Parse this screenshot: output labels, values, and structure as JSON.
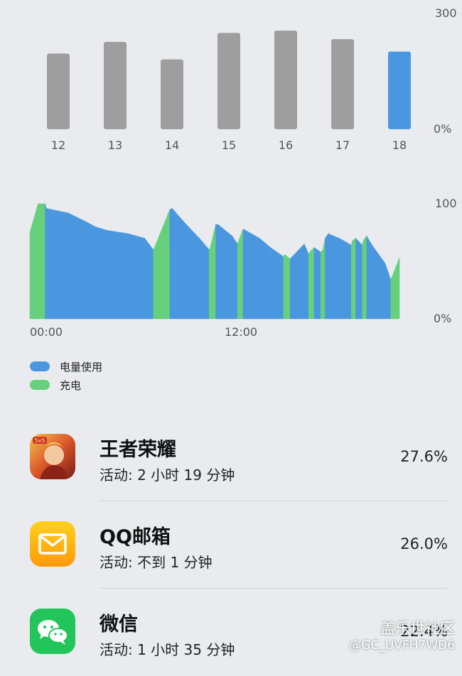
{
  "chart_data": [
    {
      "type": "bar",
      "categories": [
        "12",
        "13",
        "14",
        "15",
        "16",
        "17",
        "18"
      ],
      "values": [
        195,
        225,
        180,
        248,
        254,
        232,
        200
      ],
      "ylim": [
        0,
        300
      ],
      "ytick_labels": [
        "300",
        "0%"
      ],
      "highlight_index": 6,
      "colors": {
        "default": "#9e9e9e",
        "highlight": "#4a97e0"
      }
    },
    {
      "type": "area",
      "x_ticks": [
        "00:00",
        "12:00"
      ],
      "ytick_labels": [
        "100",
        "0%"
      ],
      "ylim": [
        0,
        100
      ],
      "series": [
        {
          "name": "电量使用",
          "color": "#4a97e0"
        },
        {
          "name": "充电",
          "color": "#66d07d"
        }
      ],
      "points": [
        [
          0,
          75,
          "c"
        ],
        [
          0.75,
          100,
          "c"
        ],
        [
          1.4,
          100,
          "c"
        ],
        [
          1.5,
          96,
          "u"
        ],
        [
          3.5,
          92,
          "u"
        ],
        [
          5,
          85,
          "u"
        ],
        [
          6,
          80,
          "u"
        ],
        [
          7,
          77,
          "u"
        ],
        [
          9,
          74,
          "u"
        ],
        [
          10.5,
          70,
          "u"
        ],
        [
          11.3,
          60,
          "u"
        ],
        [
          11.4,
          62,
          "c"
        ],
        [
          12.8,
          95,
          "c"
        ],
        [
          13,
          96,
          "u"
        ],
        [
          14.3,
          82,
          "u"
        ],
        [
          15.5,
          70,
          "u"
        ],
        [
          16.4,
          60,
          "u"
        ],
        [
          16.5,
          62,
          "c"
        ],
        [
          17,
          82,
          "c"
        ],
        [
          17.2,
          82,
          "u"
        ],
        [
          18.5,
          72,
          "u"
        ],
        [
          19,
          65,
          "u"
        ],
        [
          19.1,
          68,
          "c"
        ],
        [
          19.5,
          78,
          "c"
        ],
        [
          19.7,
          77,
          "u"
        ],
        [
          21,
          70,
          "u"
        ],
        [
          22,
          62,
          "u"
        ],
        [
          23.2,
          54,
          "u"
        ],
        [
          23.3,
          56,
          "c"
        ],
        [
          23.8,
          52,
          "c"
        ],
        [
          24,
          54,
          "u"
        ],
        [
          24.6,
          60,
          "u"
        ],
        [
          25.1,
          65,
          "u"
        ],
        [
          25.5,
          56,
          "u"
        ],
        [
          25.6,
          58,
          "c"
        ],
        [
          26,
          62,
          "c"
        ],
        [
          26.6,
          58,
          "u"
        ],
        [
          26.8,
          60,
          "c"
        ],
        [
          27,
          70,
          "c"
        ],
        [
          27.3,
          74,
          "u"
        ],
        [
          28.5,
          69,
          "u"
        ],
        [
          29.4,
          64,
          "u"
        ],
        [
          29.5,
          68,
          "c"
        ],
        [
          29.8,
          70,
          "c"
        ],
        [
          30.4,
          64,
          "u"
        ],
        [
          30.5,
          68,
          "c"
        ],
        [
          30.8,
          72,
          "c"
        ],
        [
          31.3,
          64,
          "u"
        ],
        [
          32.5,
          48,
          "u"
        ],
        [
          33,
          34,
          "u"
        ],
        [
          33.1,
          36,
          "c"
        ],
        [
          33.8,
          53,
          "c"
        ]
      ],
      "x_range": [
        0,
        33.8
      ]
    }
  ],
  "legend": [
    {
      "label": "电量使用",
      "color": "#4a97e0"
    },
    {
      "label": "充电",
      "color": "#66d07d"
    }
  ],
  "apps": [
    {
      "name": "王者荣耀",
      "activity": "活动: 2 小时 19 分钟",
      "percent": "27.6%",
      "icon": "game-icon"
    },
    {
      "name": "QQ邮箱",
      "activity": "活动: 不到 1 分钟",
      "percent": "26.0%",
      "icon": "mail-icon"
    },
    {
      "name": "微信",
      "activity": "活动: 1 小时 35 分钟",
      "percent": "22.4%",
      "icon": "wechat-icon"
    }
  ],
  "watermark": {
    "line1": "盖乐世社区",
    "line2": "@GC_UVFH7WD6"
  }
}
